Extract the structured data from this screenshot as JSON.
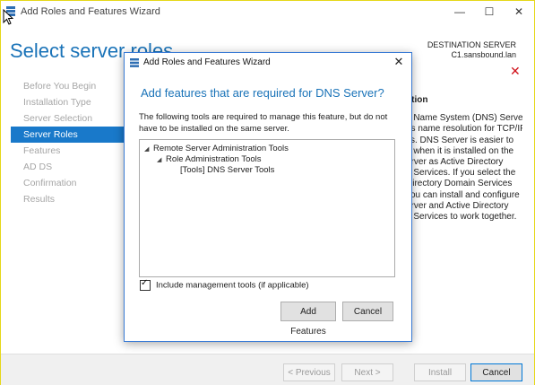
{
  "main_window": {
    "title": "Add Roles and Features Wizard",
    "minimize": "—",
    "maximize": "☐",
    "close": "✕"
  },
  "page": {
    "title": "Select server roles",
    "destination_label": "DESTINATION SERVER",
    "destination_server": "C1.sansbound.lan"
  },
  "nav": {
    "items": [
      {
        "label": "Before You Begin",
        "state": "disabled"
      },
      {
        "label": "Installation Type",
        "state": "disabled"
      },
      {
        "label": "Server Selection",
        "state": "disabled"
      },
      {
        "label": "Server Roles",
        "state": "active"
      },
      {
        "label": "Features",
        "state": "disabled"
      },
      {
        "label": "AD DS",
        "state": "disabled"
      },
      {
        "label": "Confirmation",
        "state": "disabled"
      },
      {
        "label": "Results",
        "state": "disabled"
      }
    ]
  },
  "description_panel": {
    "header": "ption",
    "lines": [
      "n Name System (DNS) Server",
      "es name resolution for TCP/IP",
      "ks. DNS Server is easier to",
      "e when it is installed on the",
      "erver as Active Directory",
      "n Services. If you select the",
      "Directory Domain Services",
      "you can install and configure",
      "erver and Active Directory",
      "n Services to work together."
    ]
  },
  "footer": {
    "previous": "< Previous",
    "next": "Next >",
    "install": "Install",
    "cancel": "Cancel"
  },
  "modal": {
    "title": "Add Roles and Features Wizard",
    "close": "✕",
    "heading": "Add features that are required for DNS Server?",
    "description": "The following tools are required to manage this feature, but do not have to be installed on the same server.",
    "tree": [
      {
        "label": "Remote Server Administration Tools",
        "level": 0,
        "expanded": true
      },
      {
        "label": "Role Administration Tools",
        "level": 1,
        "expanded": true
      },
      {
        "label": "[Tools] DNS Server Tools",
        "level": 2,
        "expanded": false
      }
    ],
    "include_tools_label": "Include management tools (if applicable)",
    "include_tools_checked": true,
    "add_features": "Add Features",
    "cancel": "Cancel"
  },
  "colors": {
    "accent": "#1a73b8",
    "nav_active": "#1979ca",
    "error_red": "#d0131c"
  }
}
